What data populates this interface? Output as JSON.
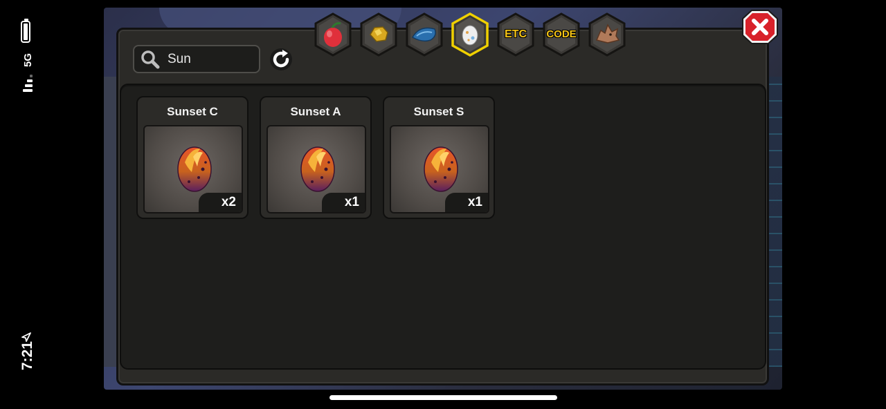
{
  "status_bar": {
    "time": "7:21",
    "network": "5G",
    "icons": [
      "battery-icon",
      "signal-icon",
      "location-arrow-icon"
    ]
  },
  "search": {
    "value": "Sun",
    "icon": "search-icon"
  },
  "refresh": {
    "icon": "refresh-icon"
  },
  "tabs": [
    {
      "id": "fruit",
      "icon": "devil-fruit-icon",
      "label": "",
      "active": false
    },
    {
      "id": "ore",
      "icon": "gold-ore-icon",
      "label": "",
      "active": false
    },
    {
      "id": "scale",
      "icon": "blue-scale-icon",
      "label": "",
      "active": false
    },
    {
      "id": "egg",
      "icon": "egg-icon",
      "label": "",
      "active": true
    },
    {
      "id": "etc",
      "icon": "",
      "label": "ETC",
      "active": false
    },
    {
      "id": "code",
      "icon": "",
      "label": "CODE",
      "active": false
    },
    {
      "id": "dragon",
      "icon": "dragon-head-icon",
      "label": "",
      "active": false
    }
  ],
  "close": {
    "icon": "close-x-icon"
  },
  "items": [
    {
      "name": "Sunset C",
      "quantity": "x2",
      "icon": "sunset-egg-icon"
    },
    {
      "name": "Sunset A",
      "quantity": "x1",
      "icon": "sunset-egg-icon"
    },
    {
      "name": "Sunset S",
      "quantity": "x1",
      "icon": "sunset-egg-icon"
    }
  ],
  "colors": {
    "panel": "#2b2a27",
    "content": "#1e1e1c",
    "active_tab_border": "#f0d000",
    "tab_label": "#f5c416",
    "close_red": "#d8212a"
  }
}
